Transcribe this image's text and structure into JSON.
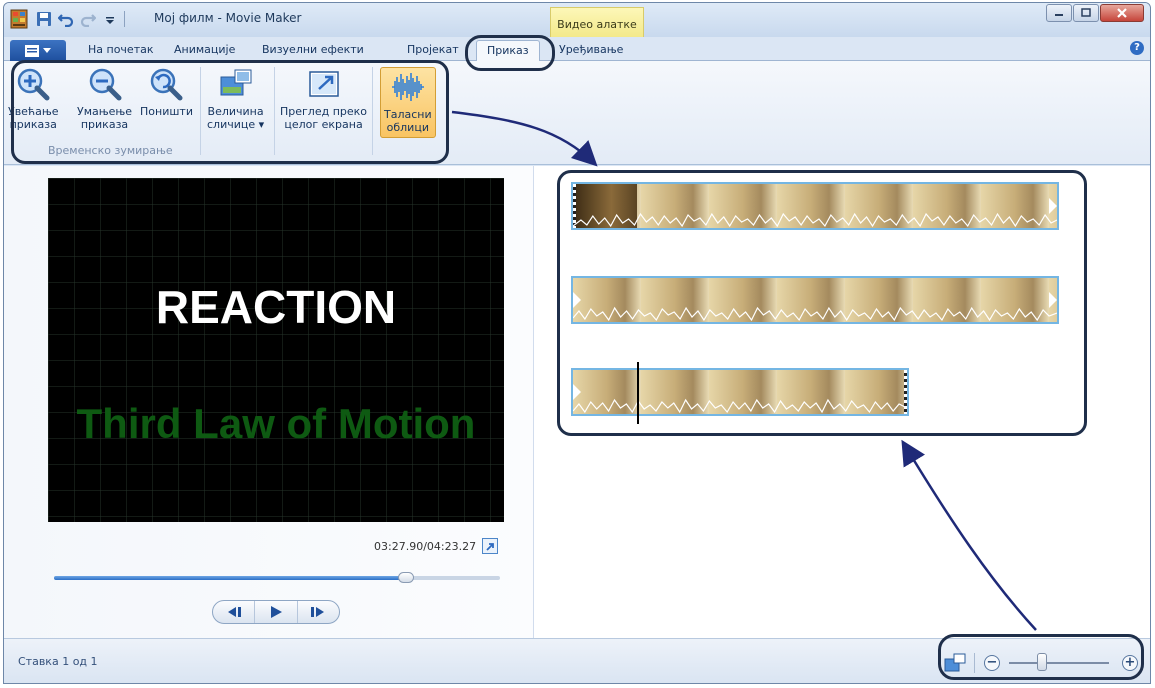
{
  "window": {
    "title": "Мој филм - Movie Maker",
    "context_tab_header": "Видео алатке"
  },
  "tabs": {
    "file_label": "",
    "items": [
      {
        "label": "На почетак",
        "active": false
      },
      {
        "label": "Анимације",
        "active": false
      },
      {
        "label": "Визуелни ефекти",
        "active": false
      },
      {
        "label": "Пројекат",
        "active": false
      },
      {
        "label": "Приказ",
        "active": true
      },
      {
        "label": "Уређивање",
        "active": false
      }
    ]
  },
  "ribbon": {
    "zoom_in_label": "Увећање\nприказа",
    "zoom_out_label": "Умањење\nприказа",
    "reset_label": "Поништи",
    "group_label": "Временско зумирање",
    "thumb_size_label": "Величина\nсличице ▾",
    "fullscreen_preview_label": "Преглед преко\nцелог екрана",
    "waveforms_label": "Таласни\nоблици"
  },
  "preview": {
    "title_text": "REACTION",
    "subtitle_text": "Third Law of Motion",
    "timecode": "03:27.90/04:23.27",
    "seek_fraction": 0.79
  },
  "status": {
    "item_text": "Ставка 1 од 1",
    "zoom_fraction": 0.33
  },
  "colors": {
    "accent_blue": "#2c6fc7",
    "ribbon_active": "#f9c463",
    "callout": "#1f2f4a",
    "clip_border": "#74b6e3",
    "subtitle_green": "#0e5a12"
  }
}
